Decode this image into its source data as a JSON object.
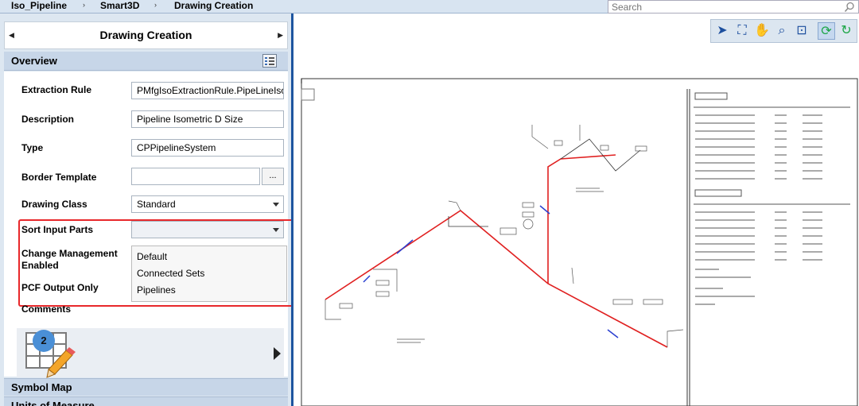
{
  "breadcrumb": {
    "items": [
      "Iso_Pipeline",
      "Smart3D",
      "Drawing Creation"
    ],
    "separator": "›"
  },
  "search": {
    "placeholder": "Search"
  },
  "panel": {
    "title": "Drawing Creation",
    "overview_label": "Overview",
    "fields": {
      "extraction_rule": {
        "label": "Extraction Rule",
        "value": "PMfgIsoExtractionRule.PipeLineIso"
      },
      "description": {
        "label": "Description",
        "value": "Pipeline Isometric D Size"
      },
      "type": {
        "label": "Type",
        "value": "CPPipelineSystem"
      },
      "border_template": {
        "label": "Border Template",
        "value": "",
        "browse_label": "..."
      },
      "drawing_class": {
        "label": "Drawing Class",
        "value": "Standard"
      },
      "sort_input_parts": {
        "label": "Sort Input Parts",
        "value": ""
      },
      "change_management": {
        "label_line1": "Change Management",
        "label_line2": "Enabled"
      },
      "pcf_output_only": {
        "label": "PCF Output Only"
      }
    },
    "sort_options": [
      "Default",
      "Connected Sets",
      "Pipelines"
    ],
    "comments": {
      "label": "Comments",
      "badge": "2"
    },
    "sections": [
      "Symbol Map",
      "Units of Measure"
    ]
  },
  "toolbar": {
    "tools": [
      "select-icon",
      "fit-icon",
      "pan-icon",
      "zoom-icon",
      "zoom-area-icon",
      "refresh-icon",
      "redo-icon"
    ]
  },
  "colors": {
    "accent": "#1e55a0",
    "highlight": "#e8282b",
    "pipe": "#e02020"
  }
}
